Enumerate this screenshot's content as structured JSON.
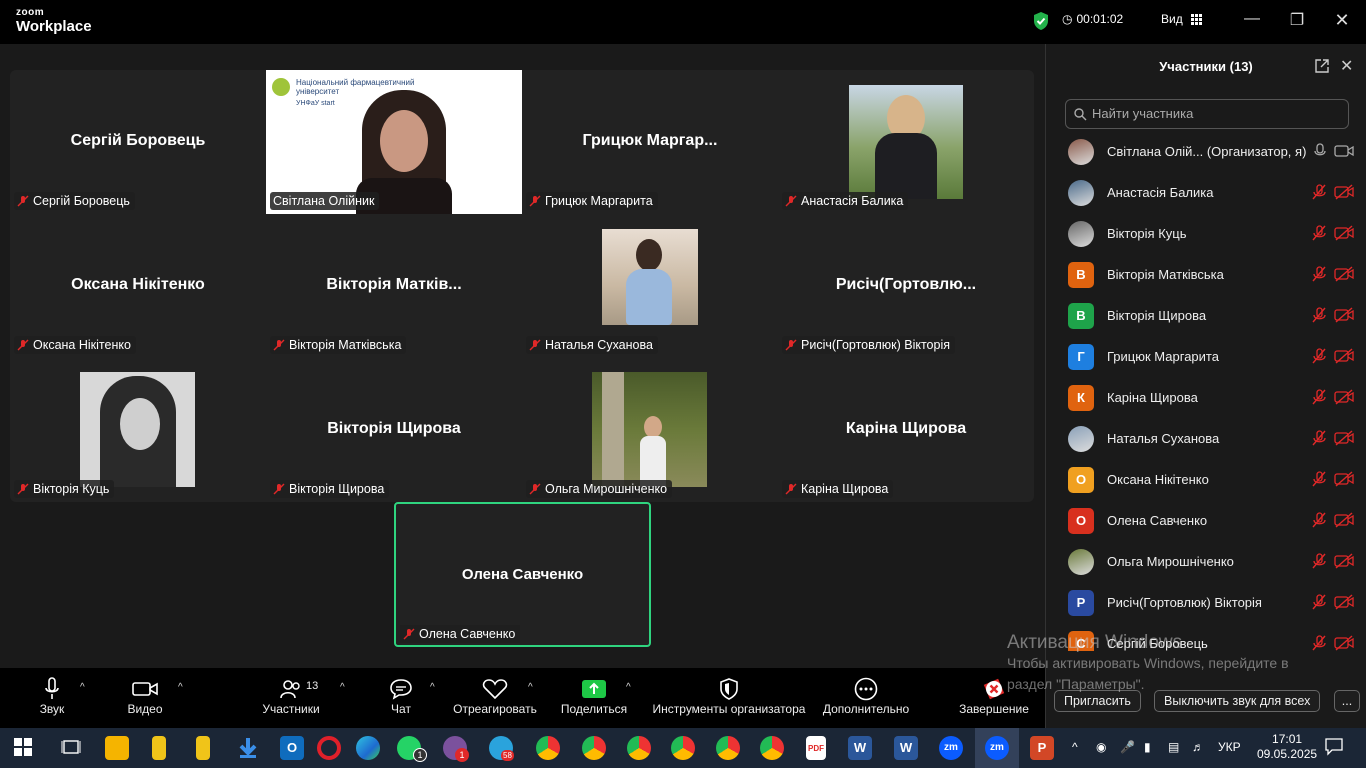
{
  "app": {
    "logo_top": "zoom",
    "logo_bottom": "Workplace"
  },
  "titlebar": {
    "timer": "00:01:02",
    "view_label": "Вид"
  },
  "grid": {
    "tiles": [
      {
        "big": "Сергій Боровець",
        "label": "Сергій Боровець"
      },
      {
        "big": "",
        "label": "Світлана Олійник"
      },
      {
        "big": "Грицюк  Маргар...",
        "label": "Грицюк Маргарита"
      },
      {
        "big": "",
        "label": "Анастасія Балика"
      },
      {
        "big": "Оксана Нікітенко",
        "label": "Оксана Нікітенко"
      },
      {
        "big": "Вікторія  Матків...",
        "label": "Вікторія Матківська"
      },
      {
        "big": "",
        "label": "Наталья Суханова"
      },
      {
        "big": "Рисіч(Гортовлю...",
        "label": "Рисіч(Гортовлюк) Вікторія"
      },
      {
        "big": "",
        "label": "Вікторія Куць"
      },
      {
        "big": "Вікторія  Щирова",
        "label": "Вікторія Щирова"
      },
      {
        "big": "",
        "label": "Ольга Мирошніченко"
      },
      {
        "big": "Каріна  Щирова",
        "label": "Каріна Щирова"
      }
    ],
    "active": {
      "big": "Олена Савченко",
      "label": "Олена Савченко"
    },
    "share_slide": {
      "org": "Національний фармацевтичний університет",
      "sub": "УНФаУ start"
    }
  },
  "toolbar": {
    "audio": "Звук",
    "video": "Видео",
    "participants": "Участники",
    "participants_count": "13",
    "chat": "Чат",
    "react": "Отреагировать",
    "share": "Поделиться",
    "host_tools": "Инструменты организатора",
    "more": "Дополнительно",
    "end": "Завершение"
  },
  "panel": {
    "title": "Участники (13)",
    "search_placeholder": "Найти участника",
    "participants": [
      {
        "name": "Світлана Олій...  (Организатор, я)",
        "initial": "",
        "color": "#8a5a4a",
        "photo": true
      },
      {
        "name": "Анастасія Балика",
        "initial": "",
        "color": "#4a6a8a",
        "photo": true
      },
      {
        "name": "Вікторія Куць",
        "initial": "",
        "color": "#666",
        "photo": true
      },
      {
        "name": "Вікторія Матківська",
        "initial": "В",
        "color": "#e0630f",
        "photo": false
      },
      {
        "name": "Вікторія Щирова",
        "initial": "В",
        "color": "#1ea34a",
        "photo": false
      },
      {
        "name": "Грицюк Маргарита",
        "initial": "Г",
        "color": "#1e7fe0",
        "photo": false
      },
      {
        "name": "Каріна Щирова",
        "initial": "К",
        "color": "#e0630f",
        "photo": false
      },
      {
        "name": "Наталья Суханова",
        "initial": "",
        "color": "#8aa0b8",
        "photo": true
      },
      {
        "name": "Оксана Нікітенко",
        "initial": "О",
        "color": "#f0a020",
        "photo": false
      },
      {
        "name": "Олена Савченко",
        "initial": "О",
        "color": "#d8301e",
        "photo": false
      },
      {
        "name": "Ольга Мирошніченко",
        "initial": "",
        "color": "#6a7a3a",
        "photo": true
      },
      {
        "name": "Рисіч(Гортовлюк) Вікторія",
        "initial": "Р",
        "color": "#2a4aa0",
        "photo": false
      },
      {
        "name": "Сергій Боровець",
        "initial": "С",
        "color": "#e0630f",
        "photo": false
      }
    ],
    "invite": "Пригласить",
    "mute_all": "Выключить звук для всех",
    "more": "..."
  },
  "watermark": {
    "line1": "Активация Windows",
    "line2": "Чтобы активировать Windows, перейдите в",
    "line3": "раздел \"Параметры\"."
  },
  "taskbar": {
    "lang": "УКР",
    "time": "17:01",
    "date": "09.05.2025",
    "badge_whatsapp": "1",
    "badge_viber": "1",
    "badge_telegram": "58"
  }
}
